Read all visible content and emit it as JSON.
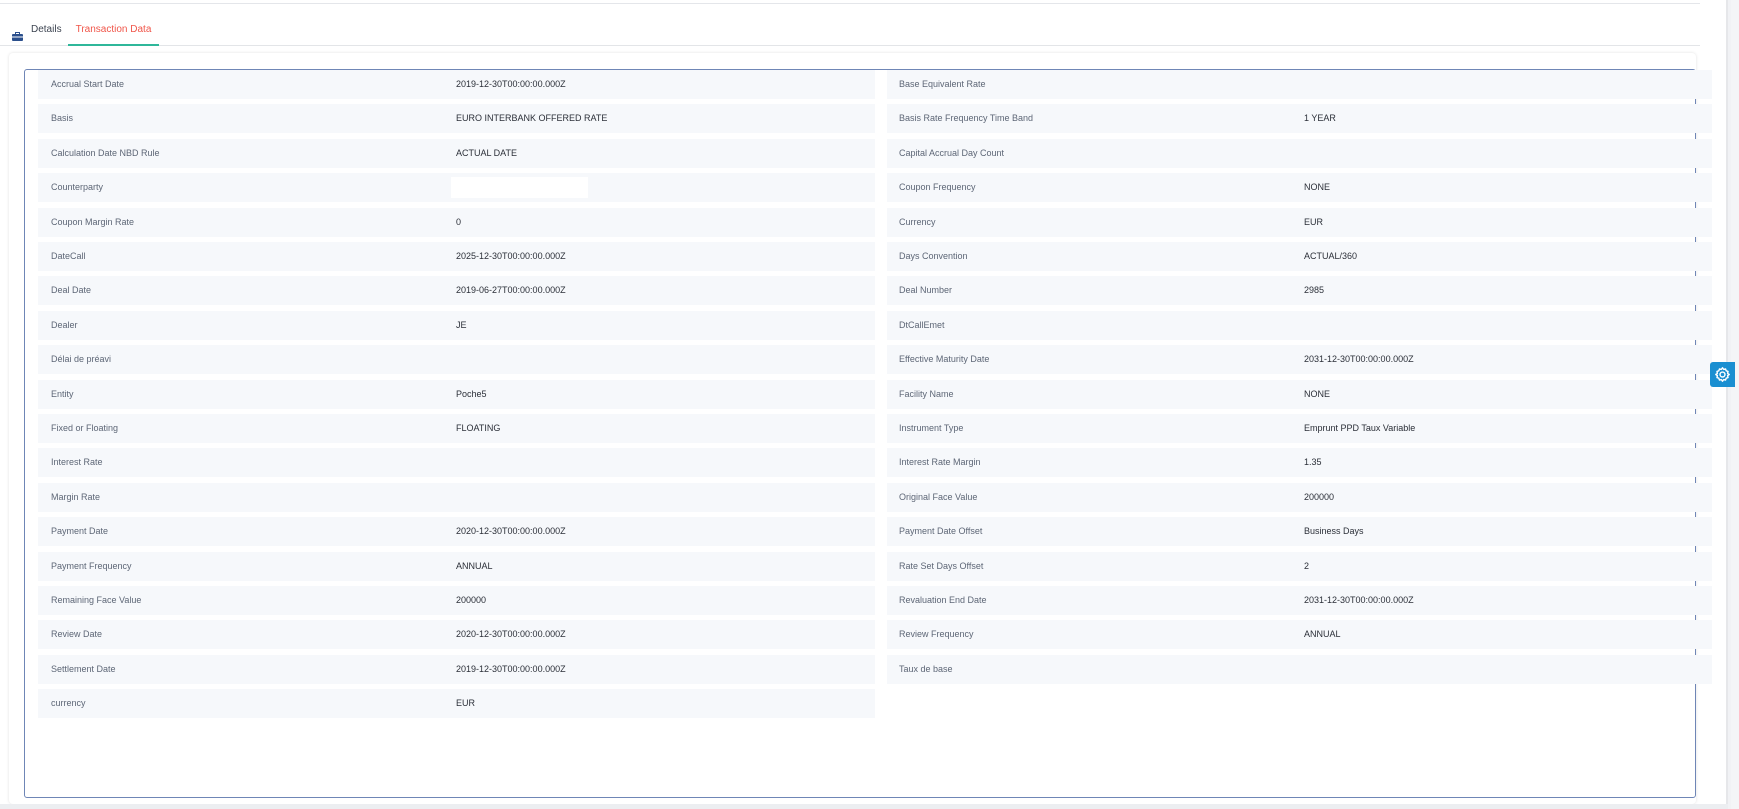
{
  "tabs": {
    "details_label": "Details",
    "transaction_label": "Transaction Data"
  },
  "colors": {
    "active_tab_text": "#f0564a",
    "active_tab_underline": "#2fb79a",
    "grid_border": "#6f86b6",
    "settings_button": "#1a8fd1"
  },
  "icons": {
    "details_tab": "briefcase-icon",
    "settings": "gear-icon"
  },
  "left_fields": [
    {
      "label": "Accrual Start Date",
      "value": "2019-12-30T00:00:00.000Z"
    },
    {
      "label": "Basis",
      "value": "EURO INTERBANK OFFERED RATE"
    },
    {
      "label": "Calculation Date NBD Rule",
      "value": "ACTUAL DATE"
    },
    {
      "label": "Counterparty",
      "value": ""
    },
    {
      "label": "Coupon Margin Rate",
      "value": "0"
    },
    {
      "label": "DateCall",
      "value": "2025-12-30T00:00:00.000Z"
    },
    {
      "label": "Deal Date",
      "value": "2019-06-27T00:00:00.000Z"
    },
    {
      "label": "Dealer",
      "value": "JE"
    },
    {
      "label": "Délai de préavi",
      "value": ""
    },
    {
      "label": "Entity",
      "value": "Poche5"
    },
    {
      "label": "Fixed or Floating",
      "value": "FLOATING"
    },
    {
      "label": "Interest Rate",
      "value": ""
    },
    {
      "label": "Margin Rate",
      "value": ""
    },
    {
      "label": "Payment Date",
      "value": "2020-12-30T00:00:00.000Z"
    },
    {
      "label": "Payment Frequency",
      "value": "ANNUAL"
    },
    {
      "label": "Remaining Face Value",
      "value": "200000"
    },
    {
      "label": "Review Date",
      "value": "2020-12-30T00:00:00.000Z"
    },
    {
      "label": "Settlement Date",
      "value": "2019-12-30T00:00:00.000Z"
    },
    {
      "label": "currency",
      "value": "EUR"
    }
  ],
  "right_fields": [
    {
      "label": "Base Equivalent Rate",
      "value": ""
    },
    {
      "label": "Basis Rate Frequency Time Band",
      "value": "1 YEAR"
    },
    {
      "label": "Capital Accrual Day Count",
      "value": ""
    },
    {
      "label": "Coupon Frequency",
      "value": "NONE"
    },
    {
      "label": "Currency",
      "value": "EUR"
    },
    {
      "label": "Days Convention",
      "value": "ACTUAL/360"
    },
    {
      "label": "Deal Number",
      "value": "2985"
    },
    {
      "label": "DtCallEmet",
      "value": ""
    },
    {
      "label": "Effective Maturity Date",
      "value": "2031-12-30T00:00:00.000Z"
    },
    {
      "label": "Facility Name",
      "value": "NONE"
    },
    {
      "label": "Instrument Type",
      "value": "Emprunt PPD Taux Variable"
    },
    {
      "label": "Interest Rate Margin",
      "value": "1.35"
    },
    {
      "label": "Original Face Value",
      "value": "200000"
    },
    {
      "label": "Payment Date Offset",
      "value": "Business Days"
    },
    {
      "label": "Rate Set Days Offset",
      "value": "2"
    },
    {
      "label": "Revaluation End Date",
      "value": "2031-12-30T00:00:00.000Z"
    },
    {
      "label": "Review Frequency",
      "value": "ANNUAL"
    },
    {
      "label": "Taux de base",
      "value": ""
    }
  ]
}
